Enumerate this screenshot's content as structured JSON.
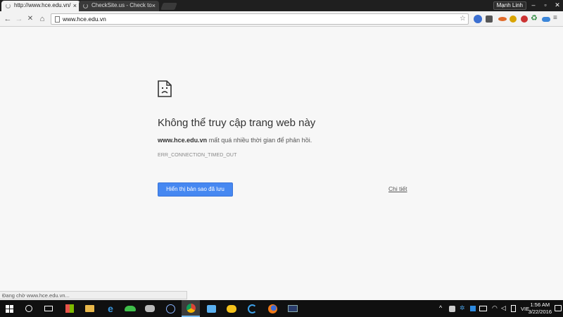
{
  "browser": {
    "tabs": [
      {
        "title": "http://www.hce.edu.vn/"
      },
      {
        "title": "CheckSite.us - Check to"
      }
    ],
    "profile_name": "Mạnh Linh",
    "address_bar": {
      "value": "www.hce.edu.vn"
    }
  },
  "error_page": {
    "title": "Không thể truy cập trang web này",
    "host": "www.hce.edu.vn",
    "message": " mất quá nhiều thời gian để phản hồi.",
    "error_code": "ERR_CONNECTION_TIMED_OUT",
    "primary_button": "Hiển thị bản sao đã lưu",
    "details_link": "Chi tiết"
  },
  "status_bar": {
    "text": "Đang chờ www.hce.edu.vn..."
  },
  "taskbar": {
    "language": "VIE",
    "time": "1:56 AM",
    "date": "3/22/2016"
  }
}
